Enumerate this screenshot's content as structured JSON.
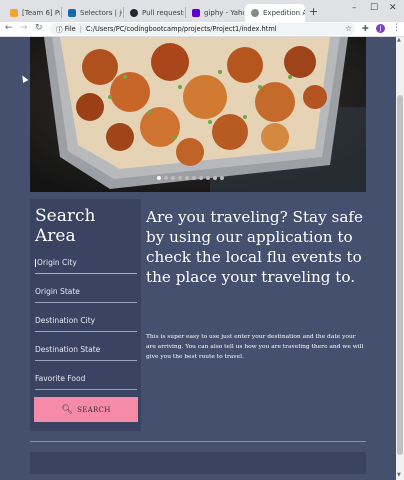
{
  "browser": {
    "tabs": [
      {
        "title": "[Team 6] Proj",
        "color": "#f4a431"
      },
      {
        "title": "Selectors | jQ",
        "color": "#1769aa"
      },
      {
        "title": "Pull requests",
        "color": "#24292e"
      },
      {
        "title": "giphy - Yahoo",
        "color": "#5f01d1"
      },
      {
        "title": "Expedition A",
        "color": "#888888"
      }
    ],
    "new_tab": "+",
    "address_prefix": "File",
    "url": "C:/Users/PC/codingbootcamp/projects/Project1/index.html",
    "avatar_letter": "J"
  },
  "carousel": {
    "indicator_count": 10,
    "active_index": 0
  },
  "search": {
    "title": "Search Area",
    "fields": [
      {
        "placeholder": "Origin City"
      },
      {
        "placeholder": "Origin State"
      },
      {
        "placeholder": "Destination City"
      },
      {
        "placeholder": "Destination State"
      },
      {
        "placeholder": "Favorite Food"
      }
    ],
    "button_label": "SEARCH"
  },
  "info": {
    "headline": "Are you traveling? Stay safe by using our application to check the local flu events to the place your traveling to.",
    "body": "This is super easy to use just enter your destination and the date your are arriving. You can also tell us how you are traveling there and we will give you the best route to travel."
  },
  "colors": {
    "page_bg": "#45506f",
    "panel_bg": "#3a4462",
    "button": "#f58ba8",
    "divider": "#b27ca9"
  }
}
